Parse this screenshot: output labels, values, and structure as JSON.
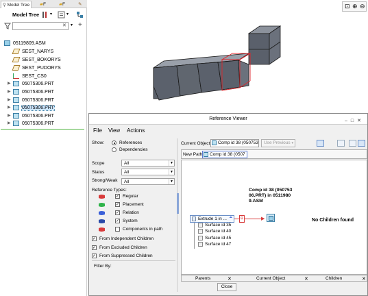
{
  "left_panel": {
    "tabs": [
      {
        "label": "Model Tree"
      },
      {
        "label": "F"
      },
      {
        "label": "F"
      },
      {
        "label": ""
      }
    ],
    "toolbar_label": "Model Tree",
    "filter_placeholder": "",
    "items": [
      {
        "label": "05119809.ASM",
        "icon": "assembly-icon"
      },
      {
        "label": "SEST_NARYS",
        "icon": "datum-plane-icon"
      },
      {
        "label": "SEST_BOKORYS",
        "icon": "datum-plane-icon"
      },
      {
        "label": "SEST_PUDORYS",
        "icon": "datum-plane-icon"
      },
      {
        "label": "SEST_CS0",
        "icon": "coordinate-system-icon"
      },
      {
        "label": "05075306.PRT",
        "icon": "part-icon"
      },
      {
        "label": "05075306.PRT",
        "icon": "part-icon"
      },
      {
        "label": "05075306.PRT",
        "icon": "part-icon"
      },
      {
        "label": "05075306.PRT",
        "icon": "part-icon",
        "selected": true
      },
      {
        "label": "05075306.PRT",
        "icon": "part-icon"
      },
      {
        "label": "05075306.PRT",
        "icon": "part-icon"
      }
    ]
  },
  "dialog": {
    "title": "Reference Viewer",
    "menus": [
      "File",
      "View",
      "Actions"
    ],
    "show_label": "Show:",
    "show_options": [
      {
        "label": "References",
        "selected": true
      },
      {
        "label": "Dependencies",
        "selected": false
      }
    ],
    "scope_label": "Scope",
    "scope_value": "All",
    "status_label": "Status",
    "status_value": "All",
    "strong_weak_label": "Strong/Weak",
    "strong_weak_value": "All",
    "reference_types_label": "Reference Types:",
    "reference_types": [
      {
        "label": "Regular",
        "checked": true,
        "color": "#d83a3a"
      },
      {
        "label": "Placement",
        "checked": true,
        "color": "#2fb34a"
      },
      {
        "label": "Relation",
        "checked": true,
        "color": "#3a5fd8"
      },
      {
        "label": "System",
        "checked": true,
        "color": "#2a4aa8"
      },
      {
        "label": "Components in path",
        "checked": false,
        "color": "#d83a3a"
      }
    ],
    "from_options": [
      {
        "label": "From Independent Children",
        "checked": true
      },
      {
        "label": "From Excluded Children",
        "checked": true
      },
      {
        "label": "From Suppressed Children",
        "checked": true
      }
    ],
    "filter_by_label": "Filter By:",
    "current_object_label": "Current Object:",
    "current_object_value": "Comp id 38 (050753",
    "use_previous_label": "Use Previous",
    "new_path_label": "New Path:",
    "new_path_value": "Comp id 38 (0507",
    "graph": {
      "parent_node_label": "Extrude 1 in ...",
      "surfaces": [
        "Surface id 35",
        "Surface id 40",
        "Surface id 45",
        "Surface id 47"
      ],
      "current_node_label": "Comp id 38 (05075306.PRT) in 05119809.ASM",
      "current_node_lines": [
        "Comp id 38 (050753",
        "06.PRT) in 0511980",
        "9.ASM"
      ],
      "no_children_label": "No Children found"
    },
    "bottom_tabs": [
      "Parents",
      "Current Object",
      "Children"
    ],
    "close_label": "Close"
  }
}
